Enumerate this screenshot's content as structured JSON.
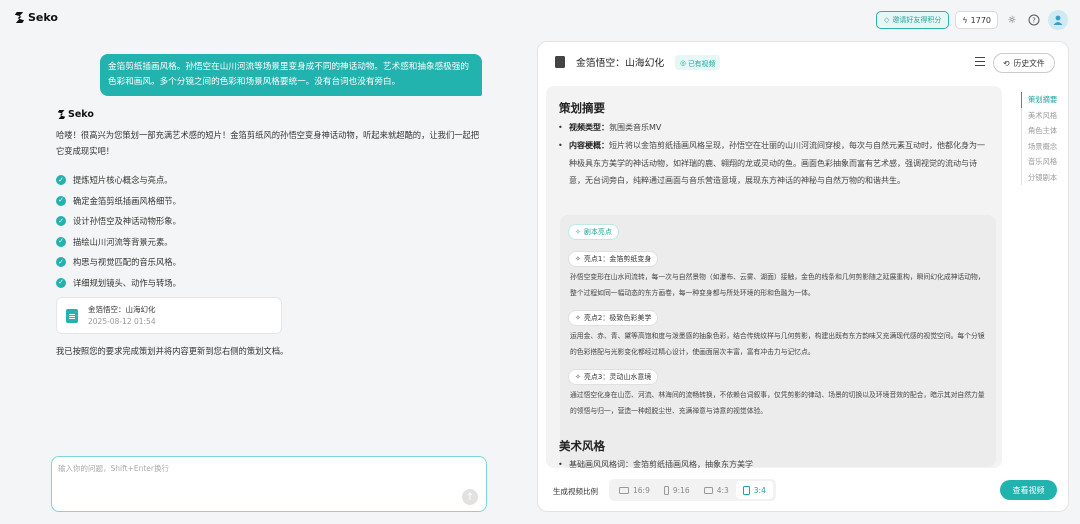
{
  "app": {
    "brand": "Seko"
  },
  "topbar": {
    "invite_label": "邀请好友得积分",
    "credits": "1770"
  },
  "chat": {
    "user_message": "金箔剪纸插画风格。孙悟空在山川河流等场景里变身成不同的神话动物。艺术感和抽象感极强的色彩和画风。多个分镜之间的色彩和场景风格要统一。没有台词也没有旁白。",
    "assistant_name": "Seko",
    "intro": "哈喽！很高兴为您策划一部充满艺术感的短片！金箔剪纸风的孙悟空变身神话动物，听起来就超酷的，让我们一起把它变成现实吧！",
    "checklist": [
      "提炼短片核心概念与亮点。",
      "确定金箔剪纸插画风格细节。",
      "设计孙悟空及神话动物形象。",
      "描绘山川河流等背景元素。",
      "构思与视觉匹配的音乐风格。",
      "详细规划镜头、动作与转场。"
    ],
    "doc_card": {
      "title": "金箔悟空：山海幻化",
      "date": "2025-08-12 01:54"
    },
    "done_text": "我已按照您的要求完成策划并将内容更新到您右侧的策划文档。",
    "input_placeholder": "输入你的问题，Shift+Enter换行"
  },
  "panel": {
    "title": "金箔悟空：山海幻化",
    "saved_badge": "已有视频",
    "history_button": "历史文件",
    "section1_heading": "策划摘要",
    "video_type_label": "视频类型：",
    "video_type_value": "氛围类音乐MV",
    "content_label": "内容梗概：",
    "content_value": "短片将以金箔剪纸插画风格呈现，孙悟空在壮丽的山川河流间穿梭，每次与自然元素互动时，他都化身为一种极具东方美学的神话动物，如祥瑞的鹿、翱翔的龙或灵动的鱼。画面色彩抽象而富有艺术感，强调视觉的流动与诗意，无台词旁白，纯粹通过画面与音乐营造意境，展现东方神话的神秘与自然万物的和谐共生。",
    "highlights_tag": "剧本亮点",
    "highlights": [
      {
        "title": "亮点1：金箔剪纸变身",
        "text": "孙悟空变形在山水间流转，每一次与自然景物（如瀑布、云雾、湖面）接触，金色的线条和几何剪影随之延展重构，瞬间幻化成神话动物，整个过程如同一幅动态的东方画卷，每一种变身都与所处环境的形和色融为一体。"
      },
      {
        "title": "亮点2：极致色彩美学",
        "text": "运用金、赤、青、黛等高饱和度与泼墨感的抽象色彩，结合传统纹样与几何剪影，构建出既有东方韵味又充满现代感的视觉空间。每个分镜的色彩搭配与光影变化都经过精心设计，使画面层次丰富，富有冲击力与记忆点。"
      },
      {
        "title": "亮点3：灵动山水意境",
        "text": "通过悟空化身在山峦、河流、林海间的流畅转换，不依赖台词叙事，仅凭剪影的律动、场景的切换以及环境音效的配合，暗示其对自然力量的领悟与归一，营造一种超脱尘世、充满禅意与诗意的视觉体验。"
      }
    ],
    "section2_heading": "美术风格",
    "art_bullet": "基础画风风格词：金箔剪纸插画风格，抽象东方美学",
    "toc": [
      "策划摘要",
      "美术风格",
      "角色主体",
      "场景概念",
      "音乐风格",
      "分镜剧本"
    ],
    "ratio_label": "生成视频比例",
    "ratios": [
      "16:9",
      "9:16",
      "4:3",
      "3:4"
    ],
    "selected_ratio": "3:4",
    "view_button": "查看视频"
  },
  "colors": {
    "accent": "#23b3ae"
  }
}
